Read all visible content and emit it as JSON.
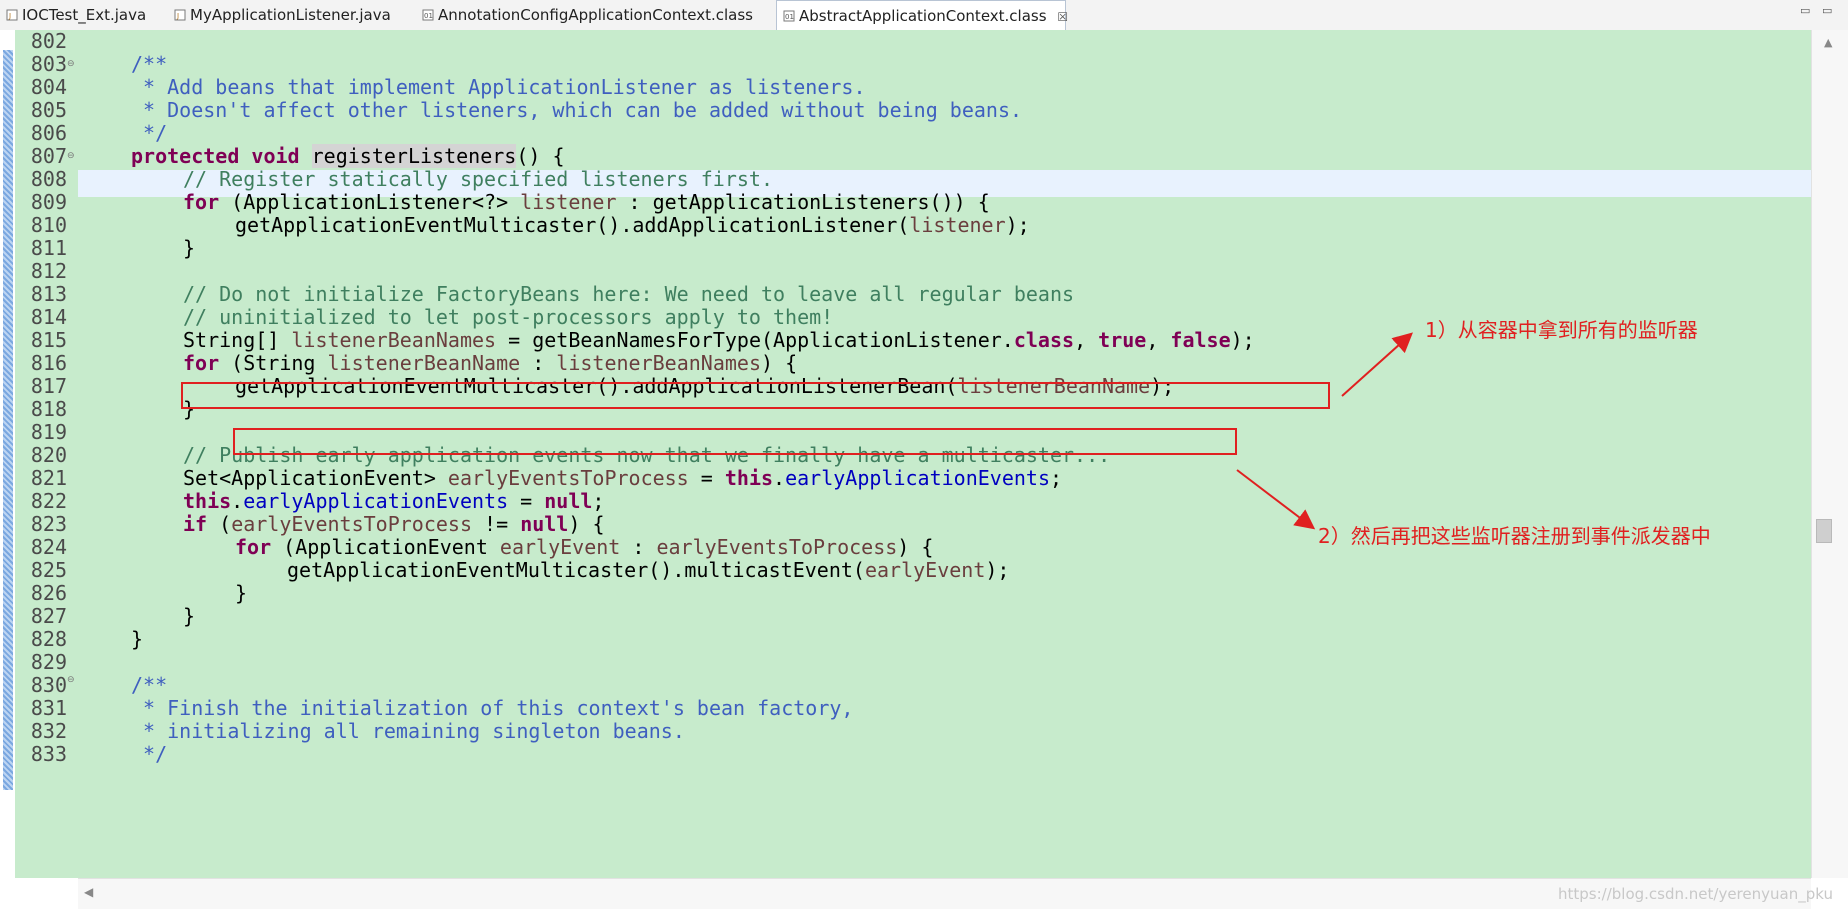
{
  "tabs": [
    {
      "label": "IOCTest_Ext.java"
    },
    {
      "label": "MyApplicationListener.java"
    },
    {
      "label": "AnnotationConfigApplicationContext.class"
    },
    {
      "label": "AbstractApplicationContext.class",
      "close": "☒"
    }
  ],
  "window_controls": {
    "minimize": "▭",
    "maximize": "▭"
  },
  "code_lines": [
    {
      "n": "802"
    },
    {
      "n": "803"
    },
    {
      "n": "804"
    },
    {
      "n": "805"
    },
    {
      "n": "806"
    },
    {
      "n": "807"
    },
    {
      "n": "808"
    },
    {
      "n": "809"
    },
    {
      "n": "810"
    },
    {
      "n": "811"
    },
    {
      "n": "812"
    },
    {
      "n": "813"
    },
    {
      "n": "814"
    },
    {
      "n": "815"
    },
    {
      "n": "816"
    },
    {
      "n": "817"
    },
    {
      "n": "818"
    },
    {
      "n": "819"
    },
    {
      "n": "820"
    },
    {
      "n": "821"
    },
    {
      "n": "822"
    },
    {
      "n": "823"
    },
    {
      "n": "824"
    },
    {
      "n": "825"
    },
    {
      "n": "826"
    },
    {
      "n": "827"
    },
    {
      "n": "828"
    },
    {
      "n": "829"
    },
    {
      "n": "830"
    },
    {
      "n": "831"
    },
    {
      "n": "832"
    },
    {
      "n": "833"
    }
  ],
  "code": {
    "l803": "/**",
    "l804": " * Add beans that implement ApplicationListener as listeners.",
    "l805": " * Doesn't affect other listeners, which can be added without being beans.",
    "l806": " */",
    "l807_kw": "protected void",
    "l807_name": "registerListeners",
    "l807_rest": "() {",
    "l808": "// Register statically specified listeners first.",
    "l809_kw": "for",
    "l809_a": " (ApplicationListener<?> ",
    "l809_var": "listener",
    "l809_b": " : getApplicationListeners()) {",
    "l810_a": "getApplicationEventMulticaster().addApplicationListener(",
    "l810_var": "listener",
    "l810_b": ");",
    "l811": "}",
    "l813": "// Do not initialize FactoryBeans here: We need to leave all regular beans",
    "l814": "// uninitialized to let post-processors apply to them!",
    "l815_a": "String[] ",
    "l815_var": "listenerBeanNames",
    "l815_b": " = getBeanNamesForType(ApplicationListener.",
    "l815_kw1": "class",
    "l815_c": ", ",
    "l815_kw2": "true",
    "l815_d": ", ",
    "l815_kw3": "false",
    "l815_e": ");",
    "l816_kw": "for",
    "l816_a": " (String ",
    "l816_var1": "listenerBeanName",
    "l816_b": " : ",
    "l816_var2": "listenerBeanNames",
    "l816_c": ") {",
    "l817_a": "getApplicationEventMulticaster().addApplicationListenerBean(",
    "l817_var": "listenerBeanName",
    "l817_b": ");",
    "l818": "}",
    "l820": "// Publish early application events now that we finally have a multicaster...",
    "l821_a": "Set<ApplicationEvent> ",
    "l821_var": "earlyEventsToProcess",
    "l821_b": " = ",
    "l821_kw": "this",
    "l821_c": ".",
    "l821_fd": "earlyApplicationEvents",
    "l821_d": ";",
    "l822_kw1": "this",
    "l822_a": ".",
    "l822_fd": "earlyApplicationEvents",
    "l822_b": " = ",
    "l822_kw2": "null",
    "l822_c": ";",
    "l823_kw1": "if",
    "l823_a": " (",
    "l823_var": "earlyEventsToProcess",
    "l823_b": " != ",
    "l823_kw2": "null",
    "l823_c": ") {",
    "l824_kw": "for",
    "l824_a": " (ApplicationEvent ",
    "l824_var1": "earlyEvent",
    "l824_b": " : ",
    "l824_var2": "earlyEventsToProcess",
    "l824_c": ") {",
    "l825_a": "getApplicationEventMulticaster().multicastEvent(",
    "l825_var": "earlyEvent",
    "l825_b": ");",
    "l826": "}",
    "l827": "}",
    "l828": "}",
    "l830": "/**",
    "l831": " * Finish the initialization of this context's bean factory,",
    "l832": " * initializing all remaining singleton beans.",
    "l833": " */"
  },
  "annotations": {
    "note1": "1）从容器中拿到所有的监听器",
    "note2": "2）然后再把这些监听器注册到事件派发器中",
    "color": "#e02020"
  },
  "watermark": "https://blog.csdn.net/yerenyuan_pku",
  "colors": {
    "editor_bg": "#c7ebcc",
    "keyword": "#7f0055",
    "javadoc": "#3f5fbf",
    "line_comment": "#3f7f5f",
    "local_var": "#6a3e3e",
    "field": "#0000c0"
  }
}
